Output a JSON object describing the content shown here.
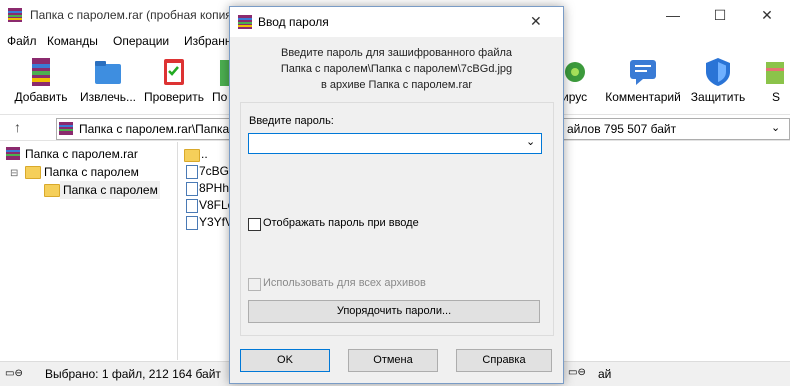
{
  "window": {
    "title": "Папка с паролем.rar (пробная копия)",
    "minimize": "—",
    "maximize": "☐",
    "close": "✕"
  },
  "menu": [
    "Файл",
    "Команды",
    "Операции",
    "Избранное"
  ],
  "toolbar": {
    "left": [
      "Добавить",
      "Извлечь...",
      "Проверить",
      "По"
    ],
    "right": [
      "ирус",
      "Комментарий",
      "Защитить",
      "S"
    ]
  },
  "address": {
    "up": "↑",
    "path": "Папка с паролем.rar\\Папка",
    "right_text": "айлов 795 507 байт"
  },
  "tree": {
    "root": "Папка с паролем.rar",
    "child": "Папка с паролем",
    "grandchild": "Папка с паролем"
  },
  "files": [
    "..",
    "7cBGd",
    "8PHh",
    "V8FLo",
    "Y3YfV"
  ],
  "status": {
    "left": "Выбрано: 1 файл, 212 164 байт",
    "right": "ай"
  },
  "dialog": {
    "title": "Ввод пароля",
    "close": "✕",
    "line1": "Введите пароль для зашифрованного файла",
    "line2": "Папка с паролем\\Папка с паролем\\7cBGd.jpg",
    "line3": "в архиве Папка с паролем.rar",
    "password_label": "Введите пароль:",
    "password_value": "",
    "show_password": "Отображать пароль при вводе",
    "use_for_all": "Использовать для всех архивов",
    "organize_button": "Упорядочить пароли...",
    "ok": "OK",
    "cancel": "Отмена",
    "help": "Справка"
  },
  "colors": {
    "dialog_border": "#7a9cc6",
    "field_border": "#0078d7",
    "button_border": "#adadad",
    "disabled_text": "#8a8a8a"
  }
}
